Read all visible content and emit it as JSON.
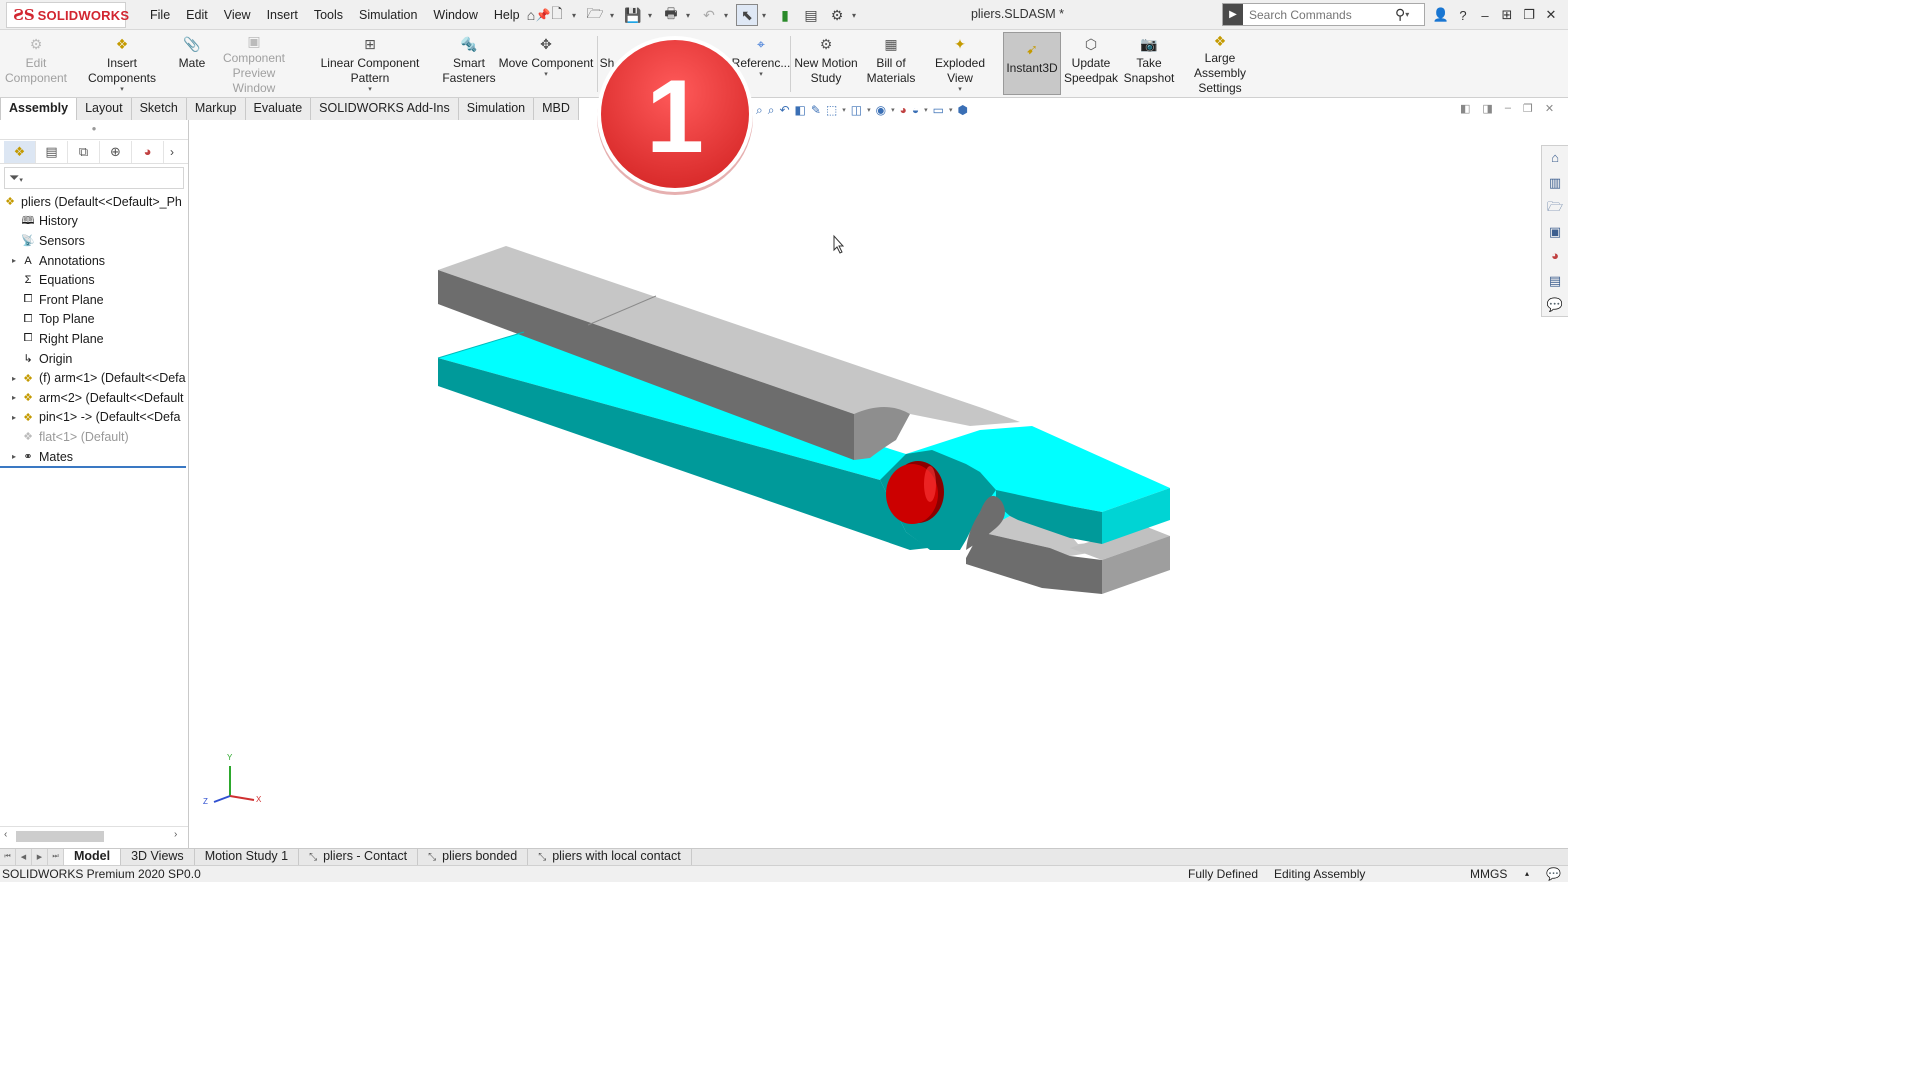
{
  "app": {
    "logo_text": "SOLIDWORKS",
    "document_title": "pliers.SLDASM *",
    "search_placeholder": "Search Commands"
  },
  "menu": [
    "File",
    "Edit",
    "View",
    "Insert",
    "Tools",
    "Simulation",
    "Window",
    "Help"
  ],
  "ribbon": {
    "edit_component": "Edit Component",
    "insert_components": "Insert Components",
    "mate": "Mate",
    "component_preview": "Component Preview Window",
    "linear_pattern": "Linear Component Pattern",
    "smart_fasteners": "Smart Fasteners",
    "move_component": "Move Component",
    "show_hidden_partial": "Sh",
    "reference_geometry": "Referenc...",
    "new_motion_study": "New Motion Study",
    "bill_of_materials": "Bill of Materials",
    "exploded_view": "Exploded View",
    "instant3d": "Instant3D",
    "update_speedpak": "Update Speedpak",
    "take_snapshot": "Take Snapshot",
    "large_assembly": "Large Assembly Settings"
  },
  "tabs": [
    {
      "label": "Assembly",
      "active": true
    },
    {
      "label": "Layout",
      "active": false
    },
    {
      "label": "Sketch",
      "active": false
    },
    {
      "label": "Markup",
      "active": false
    },
    {
      "label": "Evaluate",
      "active": false
    },
    {
      "label": "SOLIDWORKS Add-Ins",
      "active": false
    },
    {
      "label": "Simulation",
      "active": false
    },
    {
      "label": "MBD",
      "active": false
    }
  ],
  "tree": [
    {
      "label": "pliers  (Default<<Default>_Ph",
      "expander": "",
      "level": 0
    },
    {
      "label": "History",
      "expander": "",
      "level": 1
    },
    {
      "label": "Sensors",
      "expander": "",
      "level": 1
    },
    {
      "label": "Annotations",
      "expander": "▸",
      "level": 1
    },
    {
      "label": "Equations",
      "expander": "",
      "level": 1
    },
    {
      "label": "Front Plane",
      "expander": "",
      "level": 1
    },
    {
      "label": "Top Plane",
      "expander": "",
      "level": 1
    },
    {
      "label": "Right Plane",
      "expander": "",
      "level": 1
    },
    {
      "label": "Origin",
      "expander": "",
      "level": 1
    },
    {
      "label": "(f) arm<1> (Default<<Defa",
      "expander": "▸",
      "level": 1
    },
    {
      "label": "arm<2> (Default<<Default",
      "expander": "▸",
      "level": 1
    },
    {
      "label": "pin<1> -> (Default<<Defa",
      "expander": "▸",
      "level": 1
    },
    {
      "label": "flat<1> (Default)",
      "expander": "",
      "level": 1,
      "dim": true
    },
    {
      "label": "Mates",
      "expander": "▸",
      "level": 1
    }
  ],
  "triad": {
    "x": "X",
    "y": "Y",
    "z": "Z"
  },
  "badge": {
    "number": "1"
  },
  "bottom_tabs": [
    {
      "label": "Model",
      "active": true,
      "icon": ""
    },
    {
      "label": "3D Views",
      "active": false,
      "icon": ""
    },
    {
      "label": "Motion Study 1",
      "active": false,
      "icon": ""
    },
    {
      "label": "pliers - Contact",
      "active": false,
      "icon": "⤡"
    },
    {
      "label": "pliers bonded",
      "active": false,
      "icon": "⤡"
    },
    {
      "label": "pliers with local contact",
      "active": false,
      "icon": "⤡"
    }
  ],
  "status": {
    "product": "SOLIDWORKS Premium 2020 SP0.0",
    "defined": "Fully Defined",
    "mode": "Editing Assembly",
    "units": "MMGS"
  },
  "colors": {
    "arm_gray_top": "#c6c6c6",
    "arm_gray_side": "#6d6d6d",
    "arm_cyan_top": "#00ffff",
    "arm_teal_side": "#009a9a",
    "pin_red": "#cc0000",
    "badge_red": "#e83a3a"
  }
}
